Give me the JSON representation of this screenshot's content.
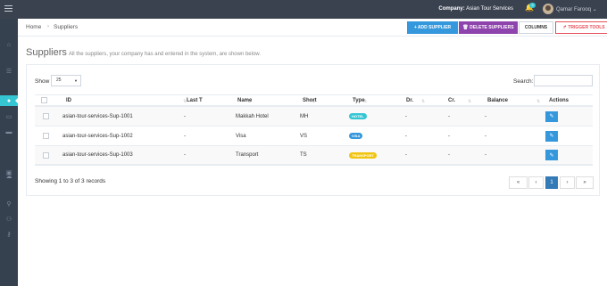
{
  "topbar": {
    "company_label": "Company:",
    "company_name": "Asian Tour Services",
    "notif_count": "3",
    "user_name": "Qamar Farooq",
    "user_caret": "⌄"
  },
  "breadcrumb": {
    "home": "Home",
    "separator": "›",
    "current": "Suppliers"
  },
  "toolbar": {
    "add_label": "+ ADD SUPPLIER",
    "delete_label": "🗑 DELETE SUPPLIERS",
    "columns_label": "COLUMNS",
    "trigger_label": "↱ TRIGGER TOOLS ⌄"
  },
  "page": {
    "title": "Suppliers",
    "subtitle": "All the suppliers, your company has and entered in the system, are shown below."
  },
  "table_controls": {
    "show_label": "Show",
    "page_size": "25",
    "search_label": "Search:",
    "search_value": ""
  },
  "table": {
    "headers": [
      "ID",
      "Last T",
      "Name",
      "Short",
      "Type",
      "Dr.",
      "Cr.",
      "Balance",
      "Actions"
    ],
    "rows": [
      {
        "id": "asian-tour-services-Sup-1001",
        "last_t": "-",
        "name": "Makkah Hotel",
        "short": "MH",
        "type": "HOTEL",
        "dr": "-",
        "cr": "-",
        "balance": "-"
      },
      {
        "id": "asian-tour-services-Sup-1002",
        "last_t": "-",
        "name": "Visa",
        "short": "VS",
        "type": "VISA",
        "dr": "-",
        "cr": "-",
        "balance": "-"
      },
      {
        "id": "asian-tour-services-Sup-1003",
        "last_t": "-",
        "name": "Transport",
        "short": "TS",
        "type": "TRANSPORT",
        "dr": "-",
        "cr": "-",
        "balance": "-"
      }
    ]
  },
  "footer": {
    "info": "Showing 1 to 3 of 3 records"
  },
  "pagination": {
    "first": "«",
    "prev": "‹",
    "current": "1",
    "next": "›",
    "last": "»"
  },
  "colors": {
    "topbar": "#3a4250",
    "sidebar": "#364150",
    "accent": "#36c6d3",
    "primary": "#3598dc",
    "purple": "#8e44ad",
    "danger": "#e7505a",
    "badge_hotel": "#36c6d3",
    "badge_visa": "#3598dc",
    "badge_transport": "#f1c40f"
  },
  "icons": {
    "sidebar": [
      "home-icon",
      "list-icon",
      "user-icon",
      "bed-icon",
      "card-icon",
      "car-icon",
      "cloud-icon",
      "user-search-icon",
      "users-icon",
      "key-icon"
    ],
    "row_action": "edit-icon",
    "notification": "bell-icon"
  }
}
